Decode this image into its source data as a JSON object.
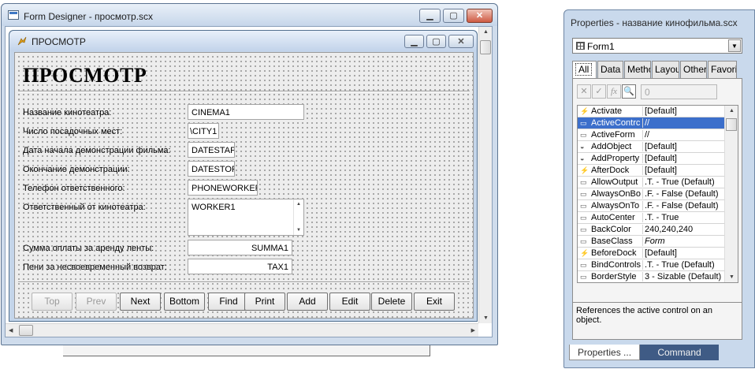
{
  "designer": {
    "title": "Form Designer - просмотр.scx"
  },
  "form": {
    "title": "ПРОСМОТР",
    "heading": "ПРОСМОТР",
    "fields": [
      {
        "label": "Название кинотеатра:",
        "value": "CINEMA1"
      },
      {
        "label": "Число посадочных мест:",
        "value": "\\CITY1"
      },
      {
        "label": "Дата начала демонстрации фильма:",
        "value": "DATESTAF"
      },
      {
        "label": "Окончание демонстрации:",
        "value": "DATESTOF"
      },
      {
        "label": "Телефон ответственного:",
        "value": "PHONEWORKER"
      },
      {
        "label": "Ответственный от кинотеатра:",
        "value": "WORKER1"
      },
      {
        "label": "Сумма оплаты за аренду ленты:",
        "value": "SUMMA1"
      },
      {
        "label": "Пени за несвоевременный возврат:",
        "value": "TAX1"
      }
    ],
    "buttons": [
      {
        "label": "Top",
        "enabled": false
      },
      {
        "label": "Prev",
        "enabled": false
      },
      {
        "label": "Next",
        "enabled": true
      },
      {
        "label": "Bottom",
        "enabled": true
      },
      {
        "label": "Find",
        "enabled": true
      },
      {
        "label": "Print",
        "enabled": true
      },
      {
        "label": "Add",
        "enabled": true
      },
      {
        "label": "Edit",
        "enabled": true
      },
      {
        "label": "Delete",
        "enabled": true
      },
      {
        "label": "Exit",
        "enabled": true
      }
    ]
  },
  "properties": {
    "title": "Properties - название кинофильма.scx",
    "object": "Form1",
    "tabs": [
      "All",
      "Data",
      "Metho",
      "Layou",
      "Other",
      "Favorit"
    ],
    "value_box": "0",
    "rows": [
      {
        "icon": "lightning-icon",
        "name": "Activate",
        "value": "[Default]"
      },
      {
        "icon": "property-icon",
        "name": "ActiveContrc",
        "value": "//",
        "selected": true
      },
      {
        "icon": "property-icon",
        "name": "ActiveForm",
        "value": "//"
      },
      {
        "icon": "method-icon",
        "name": "AddObject",
        "value": "[Default]"
      },
      {
        "icon": "method-icon",
        "name": "AddProperty",
        "value": "[Default]"
      },
      {
        "icon": "lightning-icon",
        "name": "AfterDock",
        "value": "[Default]"
      },
      {
        "icon": "property-icon",
        "name": "AllowOutput",
        "value": ".T. - True (Default)"
      },
      {
        "icon": "property-icon",
        "name": "AlwaysOnBo",
        "value": ".F. - False (Default)"
      },
      {
        "icon": "property-icon",
        "name": "AlwaysOnTo",
        "value": ".F. - False (Default)"
      },
      {
        "icon": "property-icon",
        "name": "AutoCenter",
        "value": ".T. - True"
      },
      {
        "icon": "property-icon",
        "name": "BackColor",
        "value": "240,240,240"
      },
      {
        "icon": "property-icon",
        "name": "BaseClass",
        "value": "Form"
      },
      {
        "icon": "lightning-icon",
        "name": "BeforeDock",
        "value": "[Default]"
      },
      {
        "icon": "property-icon",
        "name": "BindControls",
        "value": ".T. - True (Default)"
      },
      {
        "icon": "property-icon",
        "name": "BorderStyle",
        "value": "3 - Sizable (Default)"
      }
    ],
    "description": "References the active control on an object.",
    "bottom_tabs": [
      "Properties ...",
      "Command"
    ]
  }
}
